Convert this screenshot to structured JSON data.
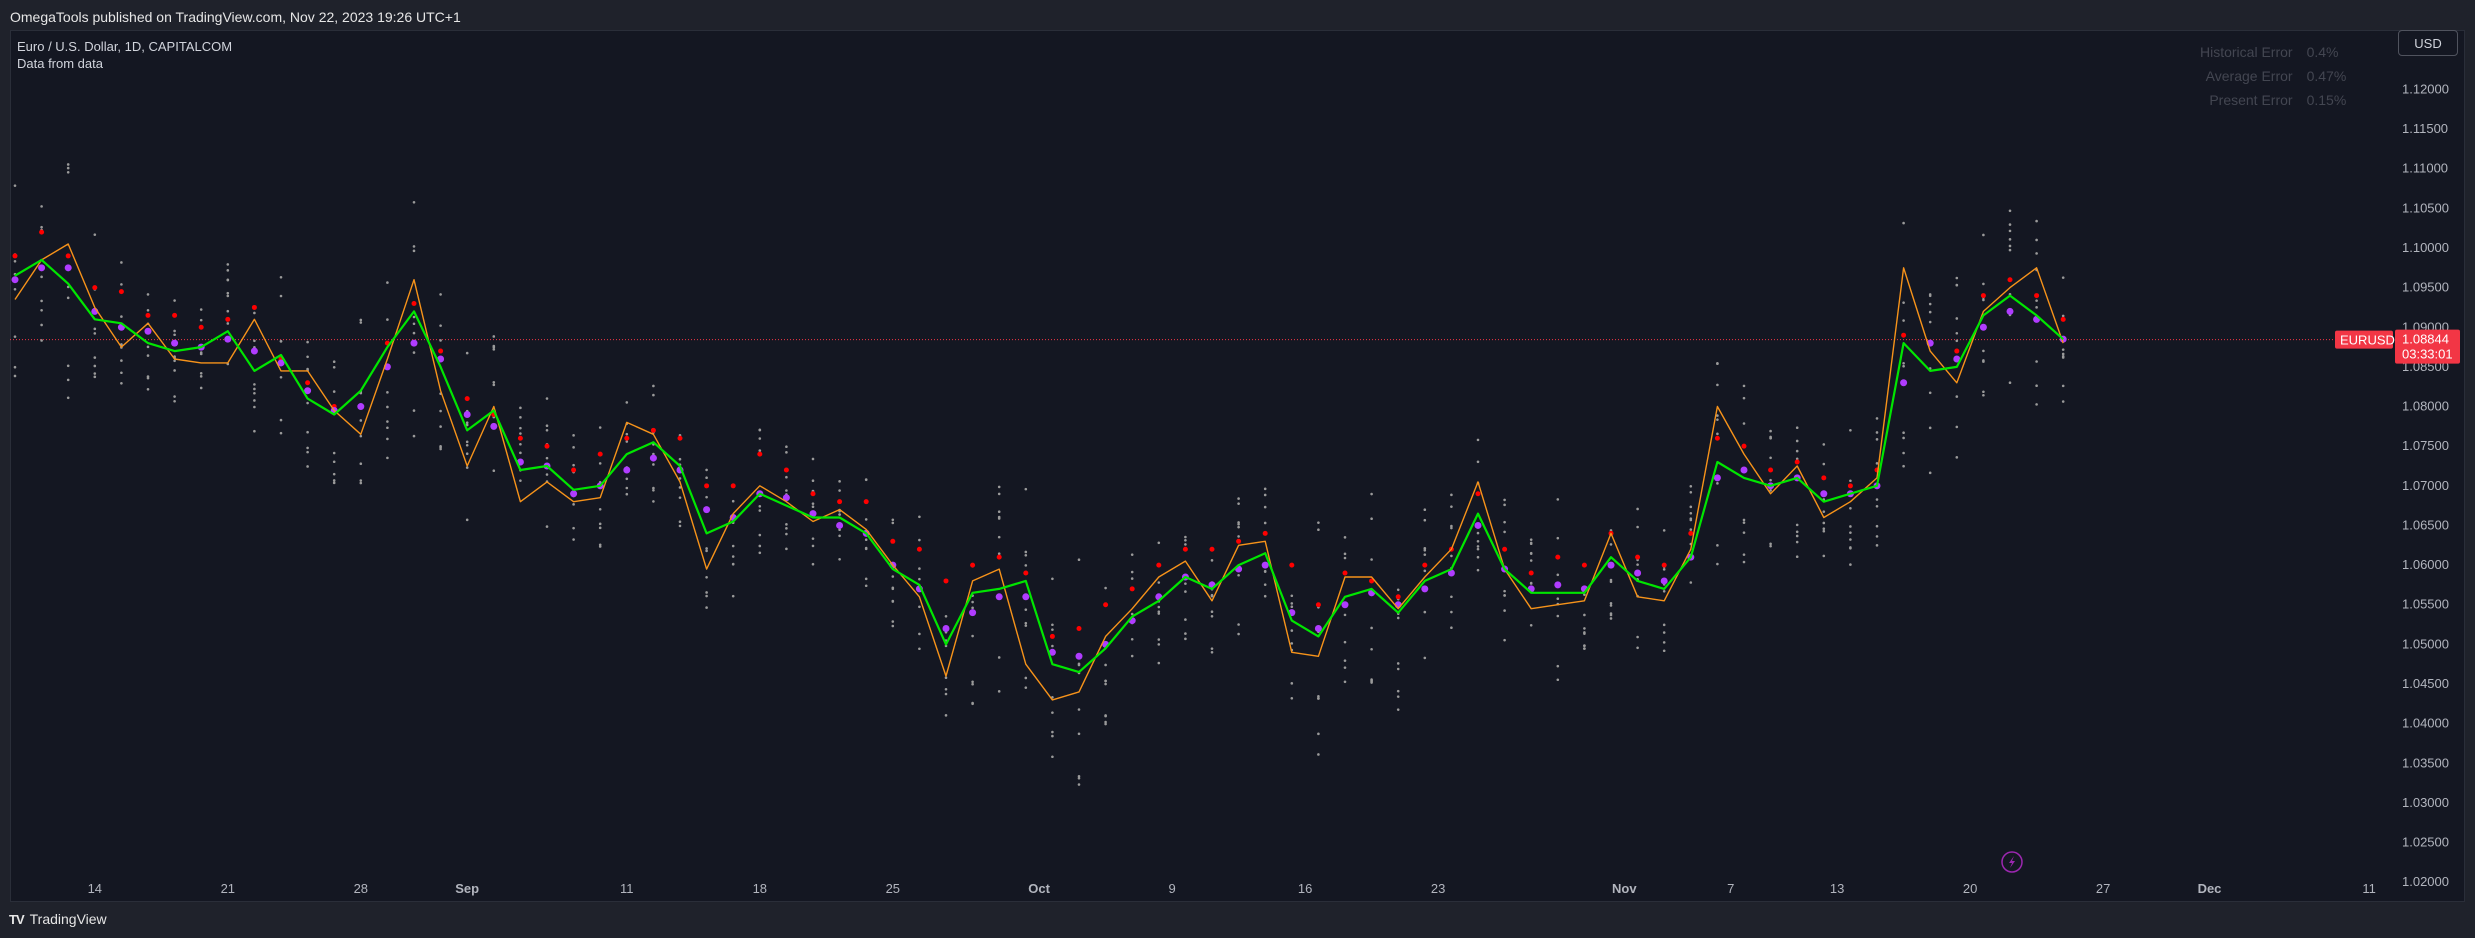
{
  "header": {
    "published": "OmegaTools published on TradingView.com, Nov 22, 2023 19:26 UTC+1"
  },
  "legend": {
    "symbol": "Euro / U.S. Dollar, 1D, CAPITALCOM",
    "indicator": "Data from data"
  },
  "error_table": {
    "rows": [
      {
        "label": "Historical Error",
        "value": "0.4%"
      },
      {
        "label": "Average Error",
        "value": "0.47%"
      },
      {
        "label": "Present Error",
        "value": "0.15%"
      }
    ]
  },
  "currency_button": "USD",
  "price_tag": {
    "symbol": "EURUSD",
    "price": "1.08844",
    "countdown": "03:33:01",
    "color": "#f23645"
  },
  "footer": {
    "brand": "TradingView"
  },
  "colors": {
    "actual": "#00e600",
    "predicted": "#f7931a",
    "red_dots": "#ff0000",
    "purple_dots": "#b03cff",
    "grey_dots": "#9a9a9a"
  },
  "chart_data": {
    "type": "line",
    "title": "",
    "ylim": [
      1.0175,
      1.1275
    ],
    "yticks": [
      "1.12000",
      "1.11500",
      "1.11000",
      "1.10500",
      "1.10000",
      "1.09500",
      "1.09000",
      "1.08500",
      "1.08000",
      "1.07500",
      "1.07000",
      "1.06500",
      "1.06000",
      "1.05500",
      "1.05000",
      "1.04500",
      "1.04000",
      "1.03500",
      "1.03000",
      "1.02500",
      "1.02000"
    ],
    "xticks": [
      {
        "label": "14",
        "index": 3,
        "bold": false
      },
      {
        "label": "21",
        "index": 8,
        "bold": false
      },
      {
        "label": "28",
        "index": 13,
        "bold": false
      },
      {
        "label": "Sep",
        "index": 17,
        "bold": true
      },
      {
        "label": "11",
        "index": 23,
        "bold": false
      },
      {
        "label": "18",
        "index": 28,
        "bold": false
      },
      {
        "label": "25",
        "index": 33,
        "bold": false
      },
      {
        "label": "Oct",
        "index": 38.5,
        "bold": true
      },
      {
        "label": "9",
        "index": 43.5,
        "bold": false
      },
      {
        "label": "16",
        "index": 48.5,
        "bold": false
      },
      {
        "label": "23",
        "index": 53.5,
        "bold": false
      },
      {
        "label": "Nov",
        "index": 60.5,
        "bold": true
      },
      {
        "label": "7",
        "index": 64.5,
        "bold": false
      },
      {
        "label": "13",
        "index": 68.5,
        "bold": false
      },
      {
        "label": "20",
        "index": 73.5,
        "bold": false
      },
      {
        "label": "27",
        "index": 78.5,
        "bold": false
      },
      {
        "label": "Dec",
        "index": 82.5,
        "bold": true
      },
      {
        "label": "11",
        "index": 88.5,
        "bold": false
      }
    ],
    "last_price": 1.08844,
    "series": [
      {
        "name": "",
        "color": "#00e600",
        "values": [
          1.0965,
          1.0985,
          1.0955,
          1.091,
          1.0905,
          1.088,
          1.087,
          1.0875,
          1.0895,
          1.0845,
          1.0865,
          1.081,
          1.079,
          1.082,
          1.0875,
          1.092,
          1.085,
          1.077,
          1.0795,
          1.072,
          1.0725,
          1.0695,
          1.07,
          1.074,
          1.0755,
          1.0725,
          1.064,
          1.0655,
          1.069,
          1.0675,
          1.066,
          1.066,
          1.064,
          1.0595,
          1.0575,
          1.05,
          1.0565,
          1.057,
          1.058,
          1.0475,
          1.0465,
          1.0495,
          1.0535,
          1.0555,
          1.0585,
          1.057,
          1.06,
          1.0615,
          1.053,
          1.051,
          1.056,
          1.057,
          1.054,
          1.058,
          1.0595,
          1.0665,
          1.0595,
          1.0565,
          1.0565,
          1.0565,
          1.061,
          1.058,
          1.057,
          1.061,
          1.073,
          1.071,
          1.07,
          1.071,
          1.068,
          1.069,
          1.07,
          1.088,
          1.0845,
          1.085,
          1.0915,
          1.094,
          1.0915,
          1.0885
        ]
      },
      {
        "name": "",
        "color": "#f7931a",
        "values": [
          1.0935,
          1.0985,
          1.1005,
          1.0925,
          1.0875,
          1.0905,
          1.086,
          1.0855,
          1.0855,
          1.091,
          1.0845,
          1.0845,
          1.0795,
          1.0765,
          1.086,
          1.096,
          1.082,
          1.0725,
          1.08,
          1.068,
          1.0705,
          1.068,
          1.0685,
          1.078,
          1.0765,
          1.0705,
          1.0595,
          1.0665,
          1.07,
          1.068,
          1.0655,
          1.067,
          1.0645,
          1.06,
          1.056,
          1.046,
          1.058,
          1.0595,
          1.0475,
          1.043,
          1.044,
          1.051,
          1.0545,
          1.0585,
          1.0605,
          1.0555,
          1.0625,
          1.063,
          1.049,
          1.0485,
          1.0585,
          1.0585,
          1.0545,
          1.0585,
          1.062,
          1.0705,
          1.0595,
          1.0545,
          1.055,
          1.0555,
          1.064,
          1.056,
          1.0555,
          1.062,
          1.08,
          1.074,
          1.069,
          1.0725,
          1.066,
          1.068,
          1.071,
          1.0975,
          1.087,
          1.083,
          1.092,
          1.095,
          1.0975,
          1.088
        ]
      }
    ],
    "dot_series": [
      {
        "name": "",
        "color": "#ff0000",
        "values": [
          1.099,
          1.102,
          1.099,
          1.095,
          1.0945,
          1.0915,
          1.0915,
          1.09,
          1.091,
          1.0925,
          1.086,
          1.083,
          1.08,
          1.08,
          1.088,
          1.093,
          1.087,
          1.081,
          1.079,
          1.076,
          1.075,
          1.072,
          1.074,
          1.076,
          1.077,
          1.076,
          1.07,
          1.07,
          1.074,
          1.072,
          1.069,
          1.068,
          1.068,
          1.063,
          1.062,
          1.058,
          1.06,
          1.061,
          1.059,
          1.051,
          1.052,
          1.055,
          1.057,
          1.06,
          1.062,
          1.062,
          1.063,
          1.064,
          1.06,
          1.055,
          1.059,
          1.058,
          1.056,
          1.06,
          1.062,
          1.069,
          1.062,
          1.059,
          1.061,
          1.06,
          1.064,
          1.061,
          1.06,
          1.064,
          1.076,
          1.075,
          1.072,
          1.073,
          1.071,
          1.07,
          1.072,
          1.089,
          1.088,
          1.087,
          1.094,
          1.096,
          1.094,
          1.091
        ]
      },
      {
        "name": "",
        "color": "#b03cff",
        "values": [
          1.096,
          1.0975,
          1.0975,
          1.092,
          1.09,
          1.0895,
          1.088,
          1.0875,
          1.0885,
          1.087,
          1.0855,
          1.082,
          1.0795,
          1.08,
          1.085,
          1.088,
          1.086,
          1.079,
          1.0775,
          1.073,
          1.0725,
          1.069,
          1.07,
          1.072,
          1.0735,
          1.072,
          1.067,
          1.066,
          1.069,
          1.0685,
          1.0665,
          1.065,
          1.064,
          1.06,
          1.057,
          1.052,
          1.054,
          1.056,
          1.056,
          1.049,
          1.0485,
          1.05,
          1.053,
          1.056,
          1.0585,
          1.0575,
          1.0595,
          1.06,
          1.054,
          1.052,
          1.055,
          1.0565,
          1.055,
          1.057,
          1.059,
          1.065,
          1.0595,
          1.057,
          1.0575,
          1.057,
          1.06,
          1.059,
          1.058,
          1.061,
          1.071,
          1.072,
          1.07,
          1.071,
          1.069,
          1.069,
          1.07,
          1.083,
          1.088,
          1.086,
          1.09,
          1.092,
          1.091,
          1.0885
        ]
      }
    ],
    "grey_dot_spread": [
      0.015,
      0.012,
      0.016,
      0.011,
      0.009,
      0.008,
      0.007,
      0.007,
      0.009,
      0.008,
      0.01,
      0.009,
      0.009,
      0.013,
      0.014,
      0.016,
      0.012,
      0.012,
      0.01,
      0.008,
      0.009,
      0.007,
      0.008,
      0.008,
      0.009,
      0.008,
      0.01,
      0.01,
      0.009,
      0.008,
      0.008,
      0.007,
      0.008,
      0.008,
      0.009,
      0.011,
      0.014,
      0.013,
      0.014,
      0.012,
      0.016,
      0.012,
      0.01,
      0.01,
      0.009,
      0.008,
      0.009,
      0.01,
      0.012,
      0.015,
      0.011,
      0.012,
      0.013,
      0.01,
      0.01,
      0.011,
      0.009,
      0.01,
      0.012,
      0.01,
      0.009,
      0.01,
      0.009,
      0.011,
      0.013,
      0.012,
      0.01,
      0.01,
      0.009,
      0.009,
      0.009,
      0.018,
      0.016,
      0.012,
      0.014,
      0.015,
      0.014,
      0.012
    ]
  }
}
